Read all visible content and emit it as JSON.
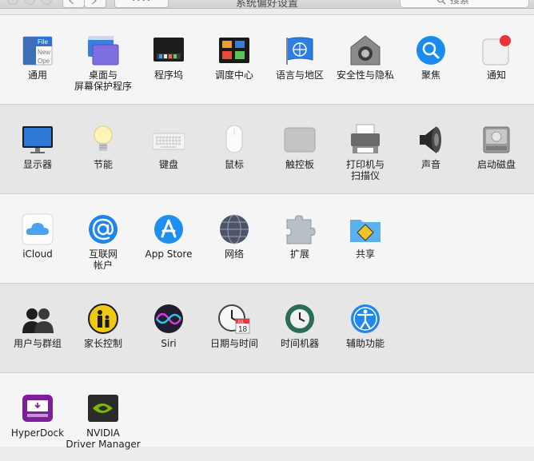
{
  "window": {
    "title": "系统偏好设置",
    "search_placeholder": "搜索",
    "grid_button_label": "••••"
  },
  "sections": [
    {
      "items": [
        {
          "id": "general",
          "label": "通用",
          "icon": "general-icon"
        },
        {
          "id": "desktop",
          "label": "桌面与",
          "label2": "屏幕保护程序",
          "icon": "desktop-screensaver-icon"
        },
        {
          "id": "dock",
          "label": "程序坞",
          "icon": "dock-icon"
        },
        {
          "id": "mission",
          "label": "调度中心",
          "icon": "mission-control-icon"
        },
        {
          "id": "language",
          "label": "语言与地区",
          "icon": "language-region-icon"
        },
        {
          "id": "security",
          "label": "安全性与隐私",
          "icon": "security-privacy-icon"
        },
        {
          "id": "spotlight",
          "label": "聚焦",
          "icon": "spotlight-icon"
        },
        {
          "id": "notifications",
          "label": "通知",
          "icon": "notifications-icon"
        }
      ]
    },
    {
      "items": [
        {
          "id": "displays",
          "label": "显示器",
          "icon": "displays-icon"
        },
        {
          "id": "energy",
          "label": "节能",
          "icon": "energy-saver-icon"
        },
        {
          "id": "keyboard",
          "label": "键盘",
          "icon": "keyboard-icon"
        },
        {
          "id": "mouse",
          "label": "鼠标",
          "icon": "mouse-icon"
        },
        {
          "id": "trackpad",
          "label": "触控板",
          "icon": "trackpad-icon"
        },
        {
          "id": "printers",
          "label": "打印机与",
          "label2": "扫描仪",
          "icon": "printer-icon"
        },
        {
          "id": "sound",
          "label": "声音",
          "icon": "sound-icon"
        },
        {
          "id": "startup",
          "label": "启动磁盘",
          "icon": "startup-disk-icon"
        }
      ]
    },
    {
      "items": [
        {
          "id": "icloud",
          "label": "iCloud",
          "icon": "icloud-icon"
        },
        {
          "id": "internet",
          "label": "互联网",
          "label2": "帐户",
          "icon": "internet-accounts-icon"
        },
        {
          "id": "appstore",
          "label": "App Store",
          "icon": "app-store-icon"
        },
        {
          "id": "network",
          "label": "网络",
          "icon": "network-icon"
        },
        {
          "id": "extensions",
          "label": "扩展",
          "icon": "extensions-icon"
        },
        {
          "id": "sharing",
          "label": "共享",
          "icon": "sharing-icon"
        }
      ]
    },
    {
      "items": [
        {
          "id": "users",
          "label": "用户与群组",
          "icon": "users-groups-icon"
        },
        {
          "id": "parental",
          "label": "家长控制",
          "icon": "parental-controls-icon"
        },
        {
          "id": "siri",
          "label": "Siri",
          "icon": "siri-icon"
        },
        {
          "id": "datetime",
          "label": "日期与时间",
          "icon": "date-time-icon"
        },
        {
          "id": "timemachine",
          "label": "时间机器",
          "icon": "time-machine-icon"
        },
        {
          "id": "accessibility",
          "label": "辅助功能",
          "icon": "accessibility-icon"
        }
      ]
    },
    {
      "items": [
        {
          "id": "hyperdock",
          "label": "HyperDock",
          "icon": "hyperdock-icon"
        },
        {
          "id": "nvidia",
          "label": "NVIDIA",
          "label2": "Driver Manager",
          "icon": "nvidia-icon"
        }
      ]
    }
  ],
  "icons_text": {
    "general_file": "File",
    "general_new": "New",
    "general_open": "Ope",
    "calendar_month": "JUL",
    "calendar_day": "18"
  },
  "colors": {
    "accent_blue": "#1a8cf0",
    "notification_red": "#f0303a"
  }
}
